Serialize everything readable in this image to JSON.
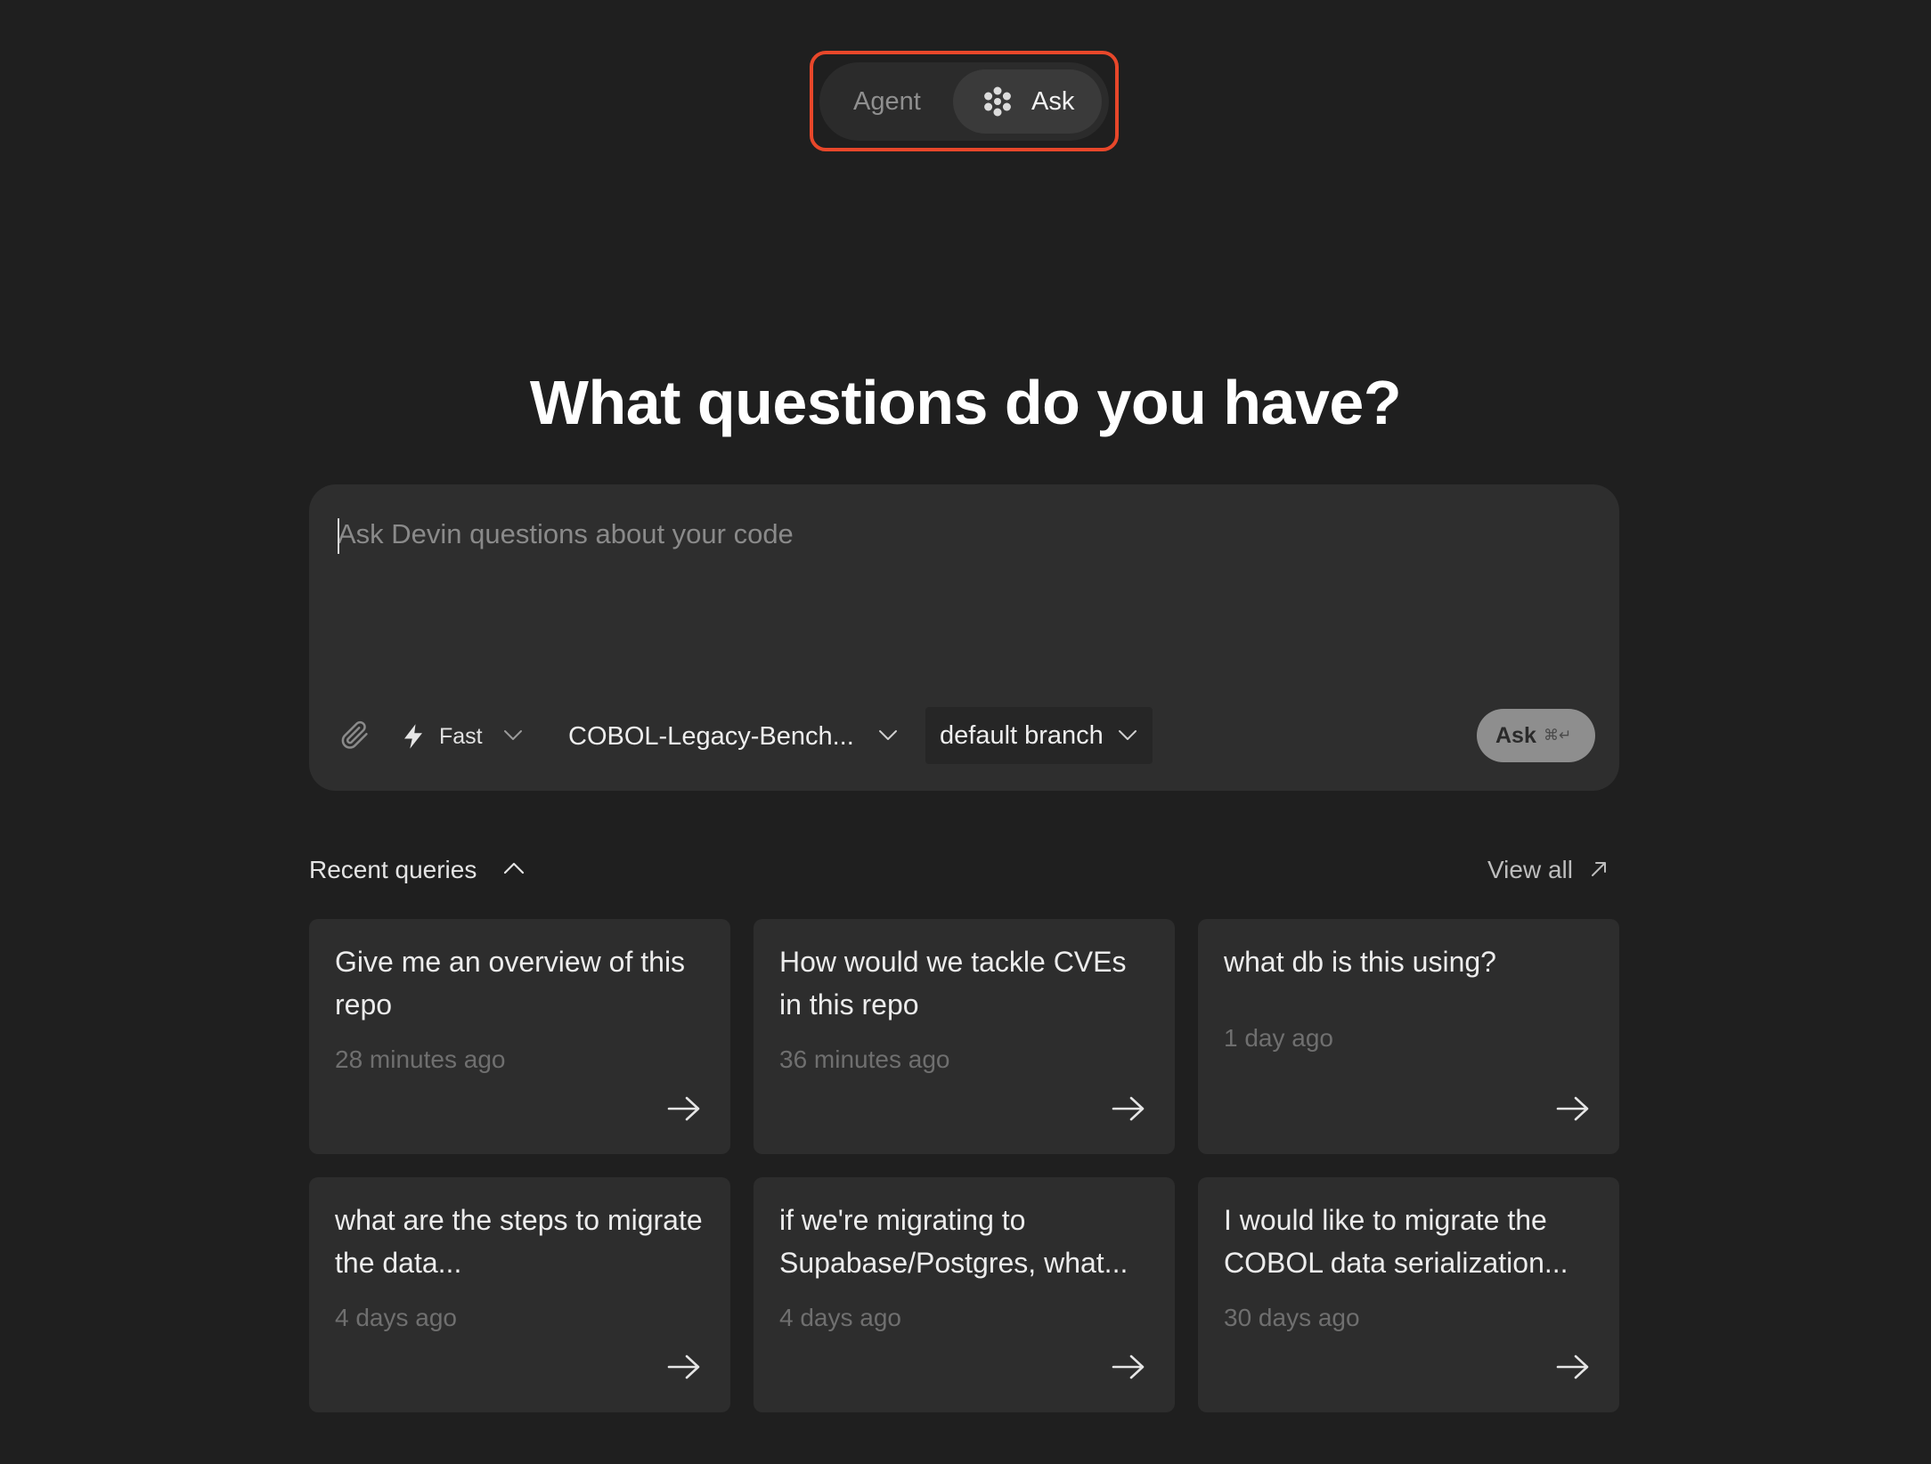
{
  "mode_toggle": {
    "options": [
      "Agent",
      "Ask"
    ],
    "selected": "Ask"
  },
  "title": "What questions do you have?",
  "composer": {
    "placeholder": "Ask Devin questions about your code",
    "value": "",
    "speed_label": "Fast",
    "repo_label": "COBOL-Legacy-Bench...",
    "branch_label": "default branch",
    "submit_label": "Ask",
    "submit_shortcut": "⌘↵"
  },
  "recent": {
    "title": "Recent queries",
    "view_all_label": "View all",
    "items": [
      {
        "question": "Give me an overview of this repo",
        "time": "28 minutes ago"
      },
      {
        "question": "How would we tackle CVEs in this repo",
        "time": "36 minutes ago"
      },
      {
        "question": "what db is this using?",
        "time": "1 day ago"
      },
      {
        "question": "what are the steps to migrate the data...",
        "time": "4 days ago"
      },
      {
        "question": "if we're migrating to Supabase/Postgres, what...",
        "time": "4 days ago"
      },
      {
        "question": "I would like to migrate the COBOL data serialization...",
        "time": "30 days ago"
      }
    ]
  },
  "colors": {
    "background": "#1f1f1f",
    "surface": "#2e2e2e",
    "card": "#2d2d2d",
    "highlight_outline": "#e8472a",
    "muted_text": "#6f6f6f"
  }
}
